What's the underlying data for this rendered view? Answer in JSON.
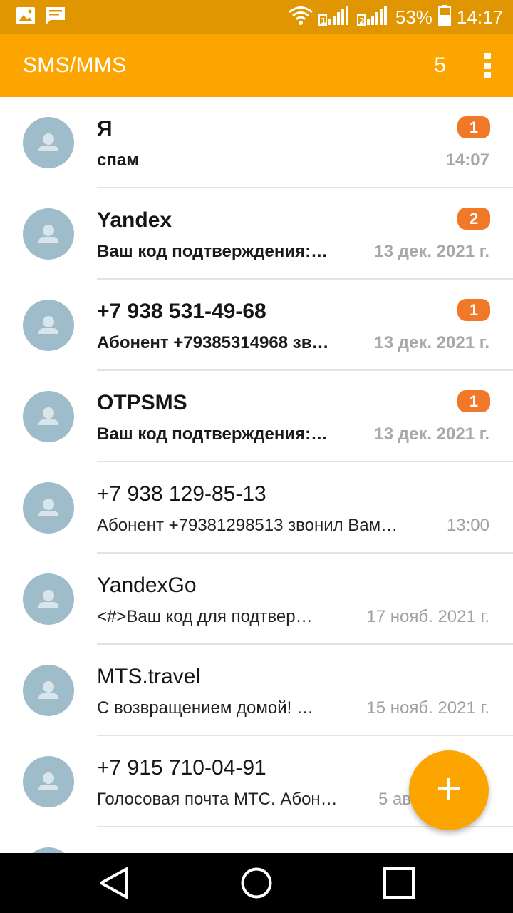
{
  "status_bar": {
    "battery_percent": "53%",
    "time": "14:17",
    "icons": [
      "gallery-icon",
      "message-icon",
      "wifi-icon",
      "sim1-signal-icon",
      "sim2-signal-icon",
      "battery-icon"
    ]
  },
  "app_bar": {
    "title": "SMS/MMS",
    "count": "5",
    "menu_icon": "overflow-menu-icon"
  },
  "conversations": [
    {
      "name": "Я",
      "preview": "спам",
      "time": "14:07",
      "unread": "1"
    },
    {
      "name": "Yandex",
      "preview": "Ваш код подтверждения:…",
      "time": "13 дек. 2021 г.",
      "unread": "2"
    },
    {
      "name": "+7 938 531-49-68",
      "preview": "Абонент +79385314968 зв…",
      "time": "13 дек. 2021 г.",
      "unread": "1"
    },
    {
      "name": "OTPSMS",
      "preview": "Ваш код подтверждения:…",
      "time": "13 дек. 2021 г.",
      "unread": "1"
    },
    {
      "name": "+7 938 129-85-13",
      "preview": "Абонент +79381298513 звонил Вам…",
      "time": "13:00"
    },
    {
      "name": "YandexGo",
      "preview": "<#>Ваш код для подтвер…",
      "time": "17 нояб. 2021 г."
    },
    {
      "name": "MTS.travel",
      "preview": "С возвращением домой!  …",
      "time": "15 нояб. 2021 г."
    },
    {
      "name": "+7 915 710-04-91",
      "preview": "Голосовая почта МТС. Абон…",
      "time": "5 ав"
    }
  ],
  "fab": {
    "icon": "plus-icon"
  },
  "nav_bar": {
    "icons": [
      "back-icon",
      "home-icon",
      "recents-icon"
    ]
  },
  "colors": {
    "status_bar": "#e09600",
    "accent": "#fca500",
    "badge": "#f07828",
    "avatar": "#9fbccb"
  }
}
